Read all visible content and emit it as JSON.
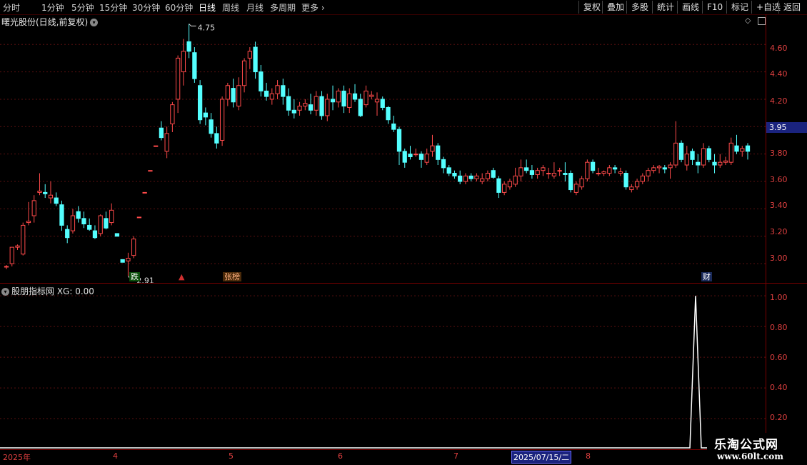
{
  "toolbar": {
    "periods": [
      "分时",
      "1分钟",
      "5分钟",
      "15分钟",
      "30分钟",
      "60分钟",
      "日线",
      "周线",
      "月线",
      "多周期",
      "更多"
    ],
    "active_period": "日线",
    "right_buttons": [
      "复权",
      "叠加",
      "多股",
      "统计",
      "画线",
      "F10",
      "标记",
      "+自选",
      "返回"
    ]
  },
  "main_panel": {
    "title": "曙光股份(日线,前复权)",
    "current_price": "3.95",
    "high_label": "4.75",
    "low_label": "2.91",
    "y_axis": [
      "4.60",
      "4.40",
      "4.20",
      "4.00",
      "3.80",
      "3.60",
      "3.40",
      "3.20",
      "3.00"
    ],
    "events": [
      "跌",
      "张榜",
      "财"
    ]
  },
  "indicator_panel": {
    "title": "股朋指标网 XG: 0.00",
    "y_axis": [
      "1.00",
      "0.80",
      "0.60",
      "0.40",
      "0.20"
    ],
    "spike_value": 1.0
  },
  "date_axis": {
    "labels": [
      "2025年",
      "4",
      "5",
      "6",
      "7",
      "8"
    ],
    "cursor_date": "2025/07/15/二"
  },
  "watermark": {
    "name": "乐淘公式网",
    "url": "www.60lt.com"
  },
  "colors": {
    "up": "#ff4a4a",
    "down": "#54ffff",
    "axis": "#e04040",
    "grid": "#5a1010"
  },
  "chart_data": {
    "type": "candlestick",
    "series": [
      {
        "name": "",
        "values": [
          [
            2.98,
            2.99,
            2.96,
            2.98
          ],
          [
            3.0,
            3.12,
            2.98,
            3.12
          ],
          [
            3.12,
            3.14,
            3.1,
            3.13
          ],
          [
            3.07,
            3.3,
            3.06,
            3.28
          ],
          [
            3.3,
            3.45,
            3.28,
            3.31
          ],
          [
            3.35,
            3.5,
            3.3,
            3.46
          ],
          [
            3.52,
            3.66,
            3.5,
            3.53
          ],
          [
            3.52,
            3.58,
            3.48,
            3.51
          ],
          [
            3.48,
            3.6,
            3.44,
            3.5
          ],
          [
            3.48,
            3.52,
            3.42,
            3.44
          ],
          [
            3.43,
            3.46,
            3.24,
            3.28
          ],
          [
            3.25,
            3.28,
            3.15,
            3.19
          ],
          [
            3.24,
            3.4,
            3.22,
            3.35
          ],
          [
            3.38,
            3.42,
            3.3,
            3.33
          ],
          [
            3.33,
            3.38,
            3.26,
            3.29
          ],
          [
            3.28,
            3.33,
            3.24,
            3.25
          ],
          [
            3.24,
            3.28,
            3.18,
            3.19
          ],
          [
            3.22,
            3.36,
            3.2,
            3.35
          ],
          [
            3.33,
            3.38,
            3.25,
            3.26
          ],
          [
            3.3,
            3.44,
            3.28,
            3.39
          ],
          [
            3.22,
            3.22,
            3.2,
            3.2
          ],
          [
            3.03,
            3.03,
            3.01,
            3.01
          ],
          [
            3.02,
            3.08,
            2.91,
            3.04
          ],
          [
            3.06,
            3.2,
            3.04,
            3.18
          ],
          [
            3.34,
            3.34,
            3.34,
            3.34
          ],
          [
            3.52,
            3.52,
            3.52,
            3.52
          ],
          [
            3.68,
            3.68,
            3.68,
            3.68
          ],
          [
            3.86,
            3.86,
            3.86,
            3.86
          ],
          [
            3.99,
            4.04,
            3.9,
            3.92
          ],
          [
            3.82,
            4.0,
            3.77,
            3.95
          ],
          [
            4.02,
            4.18,
            3.96,
            4.16
          ],
          [
            4.2,
            4.52,
            4.1,
            4.5
          ],
          [
            4.4,
            4.64,
            4.3,
            4.55
          ],
          [
            4.62,
            4.75,
            4.5,
            4.55
          ],
          [
            4.54,
            4.58,
            4.32,
            4.35
          ],
          [
            4.3,
            4.34,
            4.02,
            4.05
          ],
          [
            4.1,
            4.14,
            4.01,
            4.07
          ],
          [
            4.05,
            4.1,
            3.92,
            3.95
          ],
          [
            3.95,
            4.0,
            3.84,
            3.88
          ],
          [
            3.9,
            4.22,
            3.86,
            4.2
          ],
          [
            4.2,
            4.32,
            4.15,
            4.3
          ],
          [
            4.28,
            4.35,
            4.14,
            4.18
          ],
          [
            4.15,
            4.36,
            4.12,
            4.3
          ],
          [
            4.3,
            4.5,
            4.25,
            4.48
          ],
          [
            4.5,
            4.58,
            4.42,
            4.55
          ],
          [
            4.58,
            4.62,
            4.35,
            4.4
          ],
          [
            4.4,
            4.45,
            4.22,
            4.26
          ],
          [
            4.26,
            4.32,
            4.19,
            4.22
          ],
          [
            4.2,
            4.28,
            4.16,
            4.24
          ],
          [
            4.24,
            4.34,
            4.2,
            4.3
          ],
          [
            4.3,
            4.35,
            4.16,
            4.22
          ],
          [
            4.22,
            4.28,
            4.08,
            4.12
          ],
          [
            4.12,
            4.2,
            4.06,
            4.1
          ],
          [
            4.12,
            4.18,
            4.08,
            4.15
          ],
          [
            4.15,
            4.2,
            4.12,
            4.17
          ],
          [
            4.16,
            4.24,
            4.09,
            4.12
          ],
          [
            4.12,
            4.26,
            4.08,
            4.22
          ],
          [
            4.22,
            4.26,
            4.05,
            4.08
          ],
          [
            4.08,
            4.24,
            4.04,
            4.2
          ],
          [
            4.2,
            4.3,
            4.12,
            4.18
          ],
          [
            4.18,
            4.28,
            4.14,
            4.26
          ],
          [
            4.26,
            4.3,
            4.1,
            4.15
          ],
          [
            4.14,
            4.28,
            4.1,
            4.24
          ],
          [
            4.24,
            4.31,
            4.18,
            4.2
          ],
          [
            4.2,
            4.24,
            4.07,
            4.08
          ],
          [
            4.16,
            4.3,
            4.14,
            4.26
          ],
          [
            4.22,
            4.26,
            4.2,
            4.23
          ],
          [
            4.18,
            4.25,
            4.08,
            4.2
          ],
          [
            4.2,
            4.22,
            4.12,
            4.14
          ],
          [
            4.14,
            4.15,
            4.02,
            4.05
          ],
          [
            4.02,
            4.08,
            3.96,
            3.98
          ],
          [
            3.98,
            4.0,
            3.72,
            3.82
          ],
          [
            3.82,
            3.84,
            3.7,
            3.74
          ],
          [
            3.8,
            3.86,
            3.76,
            3.78
          ],
          [
            3.8,
            3.84,
            3.78,
            3.8
          ],
          [
            3.8,
            3.82,
            3.7,
            3.76
          ],
          [
            3.74,
            3.84,
            3.72,
            3.8
          ],
          [
            3.82,
            3.94,
            3.78,
            3.86
          ],
          [
            3.86,
            3.88,
            3.72,
            3.76
          ],
          [
            3.76,
            3.78,
            3.66,
            3.7
          ],
          [
            3.7,
            3.72,
            3.64,
            3.66
          ],
          [
            3.66,
            3.68,
            3.62,
            3.64
          ],
          [
            3.64,
            3.68,
            3.58,
            3.6
          ],
          [
            3.6,
            3.66,
            3.58,
            3.64
          ],
          [
            3.64,
            3.66,
            3.6,
            3.62
          ],
          [
            3.62,
            3.66,
            3.6,
            3.64
          ],
          [
            3.6,
            3.66,
            3.58,
            3.62
          ],
          [
            3.62,
            3.68,
            3.6,
            3.66
          ],
          [
            3.68,
            3.7,
            3.62,
            3.63
          ],
          [
            3.62,
            3.64,
            3.48,
            3.52
          ],
          [
            3.52,
            3.6,
            3.5,
            3.58
          ],
          [
            3.56,
            3.62,
            3.54,
            3.6
          ],
          [
            3.58,
            3.7,
            3.56,
            3.64
          ],
          [
            3.64,
            3.76,
            3.6,
            3.7
          ],
          [
            3.7,
            3.76,
            3.66,
            3.68
          ],
          [
            3.68,
            3.72,
            3.62,
            3.65
          ],
          [
            3.65,
            3.7,
            3.62,
            3.68
          ],
          [
            3.68,
            3.72,
            3.64,
            3.7
          ],
          [
            3.66,
            3.7,
            3.62,
            3.66
          ],
          [
            3.64,
            3.74,
            3.62,
            3.66
          ],
          [
            3.68,
            3.7,
            3.64,
            3.68
          ],
          [
            3.66,
            3.74,
            3.6,
            3.65
          ],
          [
            3.66,
            3.68,
            3.52,
            3.54
          ],
          [
            3.52,
            3.6,
            3.5,
            3.58
          ],
          [
            3.56,
            3.64,
            3.54,
            3.62
          ],
          [
            3.62,
            3.76,
            3.6,
            3.74
          ],
          [
            3.74,
            3.76,
            3.66,
            3.68
          ],
          [
            3.66,
            3.7,
            3.64,
            3.66
          ],
          [
            3.66,
            3.68,
            3.64,
            3.67
          ],
          [
            3.66,
            3.72,
            3.64,
            3.7
          ],
          [
            3.7,
            3.72,
            3.66,
            3.69
          ],
          [
            3.66,
            3.7,
            3.64,
            3.67
          ],
          [
            3.66,
            3.68,
            3.54,
            3.56
          ],
          [
            3.54,
            3.58,
            3.52,
            3.56
          ],
          [
            3.56,
            3.62,
            3.54,
            3.6
          ],
          [
            3.6,
            3.66,
            3.58,
            3.64
          ],
          [
            3.64,
            3.7,
            3.6,
            3.68
          ],
          [
            3.68,
            3.72,
            3.66,
            3.7
          ],
          [
            3.7,
            3.72,
            3.66,
            3.71
          ],
          [
            3.7,
            3.72,
            3.66,
            3.69
          ],
          [
            3.7,
            3.74,
            3.62,
            3.72
          ],
          [
            3.72,
            4.04,
            3.7,
            3.88
          ],
          [
            3.88,
            3.9,
            3.74,
            3.76
          ],
          [
            3.72,
            3.86,
            3.68,
            3.8
          ],
          [
            3.82,
            3.84,
            3.72,
            3.76
          ],
          [
            3.74,
            3.8,
            3.66,
            3.72
          ],
          [
            3.72,
            3.88,
            3.7,
            3.84
          ],
          [
            3.84,
            3.86,
            3.74,
            3.76
          ],
          [
            3.74,
            3.8,
            3.66,
            3.72
          ],
          [
            3.72,
            3.8,
            3.7,
            3.74
          ],
          [
            3.74,
            3.78,
            3.72,
            3.75
          ],
          [
            3.74,
            3.92,
            3.72,
            3.88
          ],
          [
            3.86,
            3.94,
            3.8,
            3.82
          ],
          [
            3.82,
            3.86,
            3.78,
            3.84
          ],
          [
            3.86,
            3.88,
            3.76,
            3.82
          ]
        ]
      }
    ],
    "ylim": [
      2.86,
      4.82
    ],
    "indicator": {
      "name": "XG",
      "ylim": [
        0,
        1.08
      ],
      "values": "0 except spike 1.00 at second-to-last bars"
    }
  }
}
